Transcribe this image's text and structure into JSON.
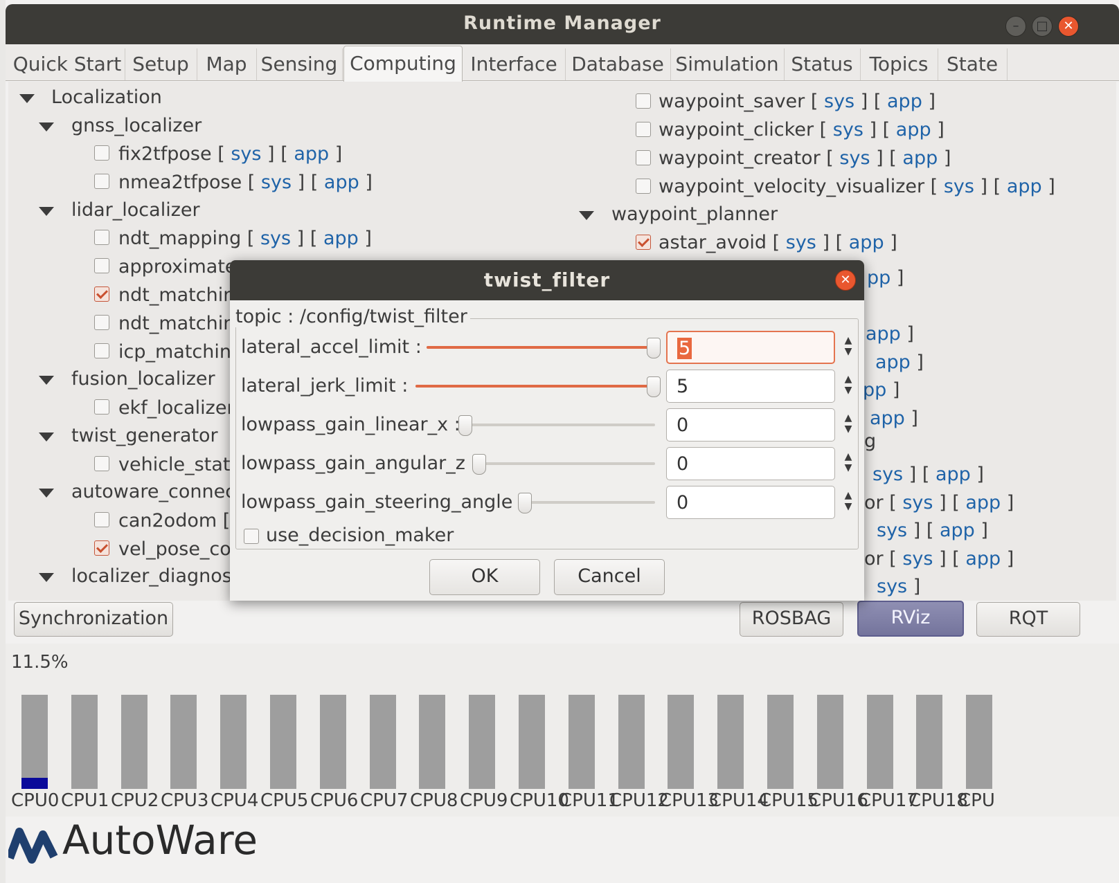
{
  "window": {
    "title": "Runtime Manager"
  },
  "tabs": [
    "Quick Start",
    "Setup",
    "Map",
    "Sensing",
    "Computing",
    "Interface",
    "Database",
    "Simulation",
    "Status",
    "Topics",
    "State"
  ],
  "tree_left": {
    "localization": "Localization",
    "gnss_localizer": "gnss_localizer",
    "fix2tfpose": "fix2tfpose",
    "nmea2tfpose": "nmea2tfpose",
    "lidar_localizer": "lidar_localizer",
    "ndt_mapping": "ndt_mapping",
    "approximate": "approximate",
    "ndt_matching1": "ndt_matchin",
    "ndt_matching2": "ndt_matchin",
    "icp_matching": "icp_matching",
    "fusion_localizer": "fusion_localizer",
    "ekf_localizer": "ekf_localizer",
    "twist_generator": "twist_generator",
    "vehicle_status": "vehicle_statu",
    "autoware_connector": "autoware_connec",
    "can2odom": "can2odom",
    "vel_pose": "vel_pose_co",
    "localizer_diagnostics": "localizer_diagnos"
  },
  "tree_right": {
    "waypoint_saver": "waypoint_saver",
    "waypoint_clicker": "waypoint_clicker",
    "waypoint_creator": "waypoint_creator",
    "waypoint_velocity_visualizer": "waypoint_velocity_visualizer",
    "waypoint_planner": "waypoint_planner",
    "astar_avoid": "astar_avoid",
    "partial_or1": "or",
    "partial_or2": "or",
    "partial_g": "g"
  },
  "links": {
    "sys": "sys",
    "app": "app",
    "app_partial": "pp",
    "open": "[",
    "close": "]"
  },
  "bottom_buttons": {
    "sync": "Synchronization",
    "rosbag": "ROSBAG",
    "rviz": "RViz",
    "rqt": "RQT"
  },
  "cpu": {
    "usage_label": "11.5%",
    "labels": [
      "CPU0",
      "CPU1",
      "CPU2",
      "CPU3",
      "CPU4",
      "CPU5",
      "CPU6",
      "CPU7",
      "CPU8",
      "CPU9",
      "CPU10",
      "CPU11",
      "CPU12",
      "CPU13",
      "CPU14",
      "CPU15",
      "CPU16",
      "CPU17",
      "CPU18",
      "CPU"
    ],
    "usage_fraction": [
      0.12,
      0,
      0,
      0,
      0,
      0,
      0,
      0,
      0,
      0,
      0,
      0,
      0,
      0,
      0,
      0,
      0,
      0,
      0,
      0
    ]
  },
  "brand": {
    "logo_text": "AutoWare"
  },
  "dialog": {
    "title": "twist_filter",
    "topic": "topic : /config/twist_filter",
    "params": [
      {
        "label": "lateral_accel_limit :",
        "value": "5",
        "slider": 1.0
      },
      {
        "label": "lateral_jerk_limit :",
        "value": "5",
        "slider": 1.0
      },
      {
        "label": "lowpass_gain_linear_x :",
        "value": "0",
        "slider": 0.0
      },
      {
        "label": "lowpass_gain_angular_z :",
        "value": "0",
        "slider": 0.0
      },
      {
        "label": "lowpass_gain_steering_angle :",
        "value": "0",
        "slider": 0.0
      }
    ],
    "use_decision_maker": "use_decision_maker",
    "ok": "OK",
    "cancel": "Cancel"
  },
  "colors": {
    "accent": "#e06a45",
    "link": "#1f63a8",
    "titlebar": "#3c3b37",
    "cpu_fill": "#0a0a9a"
  }
}
